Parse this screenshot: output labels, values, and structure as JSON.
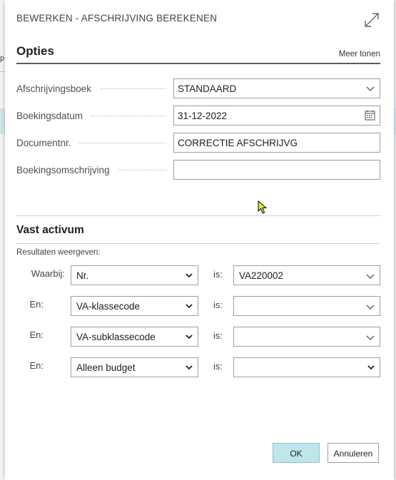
{
  "dialog": {
    "title": "BEWERKEN - AFSCHRIJVING BEREKENEN",
    "background_letter": "p"
  },
  "options": {
    "heading": "Opties",
    "more_label": "Meer tonen",
    "fields": [
      {
        "label": "Afschrijvingsboek",
        "value": "STANDAARD",
        "control": "dropdown"
      },
      {
        "label": "Boekingsdatum",
        "value": "31-12-2022",
        "control": "date"
      },
      {
        "label": "Documentnr.",
        "value": "CORRECTIE AFSCHRIJVG",
        "control": "text"
      },
      {
        "label": "Boekingsomschrijving",
        "value": "",
        "control": "text"
      }
    ]
  },
  "fixed_asset": {
    "heading": "Vast activum",
    "results_label": "Resultaten weergeven:",
    "is_label": "is:",
    "filters": [
      {
        "label": "Waarbij:",
        "field": "Nr.",
        "value": "VA220002"
      },
      {
        "label": "En:",
        "field": "VA-klassecode",
        "value": ""
      },
      {
        "label": "En:",
        "field": "VA-subklassecode",
        "value": ""
      },
      {
        "label": "En:",
        "field": "Alleen budget",
        "value": ""
      }
    ]
  },
  "buttons": {
    "ok": "OK",
    "cancel": "Annuleren"
  },
  "colors": {
    "accent": "#bfe6ea",
    "background_strip": "#d3e5e8"
  }
}
